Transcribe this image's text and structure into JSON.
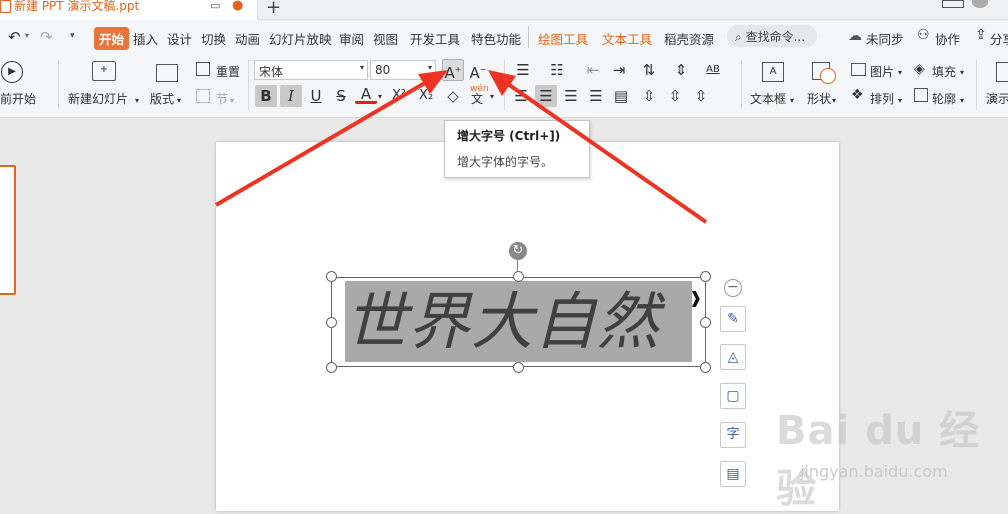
{
  "tab": {
    "title": "新建 PPT 演示文稿.ppt",
    "new_tab": "+"
  },
  "menu": {
    "items": [
      "开始",
      "插入",
      "设计",
      "切换",
      "动画",
      "幻灯片放映",
      "审阅",
      "视图",
      "开发工具",
      "特色功能"
    ],
    "context": [
      "绘图工具",
      "文本工具"
    ],
    "extra": "稻壳资源",
    "search": "查找命令...",
    "right": [
      "未同步",
      "协作",
      "分享"
    ]
  },
  "ribbon": {
    "play_label": "当前开始",
    "new_slide": "新建幻灯片",
    "layout": "版式",
    "reset": "重置",
    "section": "节",
    "font_name": "宋体",
    "font_size": "80",
    "grow_glyph": "A",
    "shrink_glyph": "A",
    "textbox": "文本框",
    "shape": "形状",
    "picture": "图片",
    "fill": "填充",
    "arrange": "排列",
    "outline": "轮廓",
    "present": "演示",
    "ruby": "wén"
  },
  "tooltip": {
    "title": "增大字号 (Ctrl+])",
    "desc": "增大字体的字号。"
  },
  "slide": {
    "text": "世界大自然"
  },
  "watermark": {
    "logo": "Bai du 经验",
    "url": "jingyan.baidu.com"
  },
  "colors": {
    "accent": "#e2641f",
    "arrow": "#ee3322",
    "highlight": "#a9a9a9"
  },
  "icons": [
    "undo-icon",
    "redo-icon",
    "play-icon",
    "new-slide-icon",
    "layout-icon",
    "reset-icon",
    "section-icon",
    "grow-font-icon",
    "shrink-font-icon",
    "bold-icon",
    "italic-icon",
    "underline-icon",
    "strike-icon",
    "font-color-icon",
    "clear-format-icon",
    "ruby-icon",
    "bullets-icon",
    "numbering-icon",
    "align-left-icon",
    "align-center-icon",
    "align-right-icon",
    "justify-icon",
    "textbox-icon",
    "shape-icon",
    "picture-icon",
    "fill-icon",
    "arrange-icon",
    "outline-icon",
    "search-icon",
    "cloud-icon",
    "rotate-icon",
    "pen-icon",
    "fill-format-icon",
    "border-icon",
    "text-format-icon",
    "textbox-format-icon"
  ]
}
